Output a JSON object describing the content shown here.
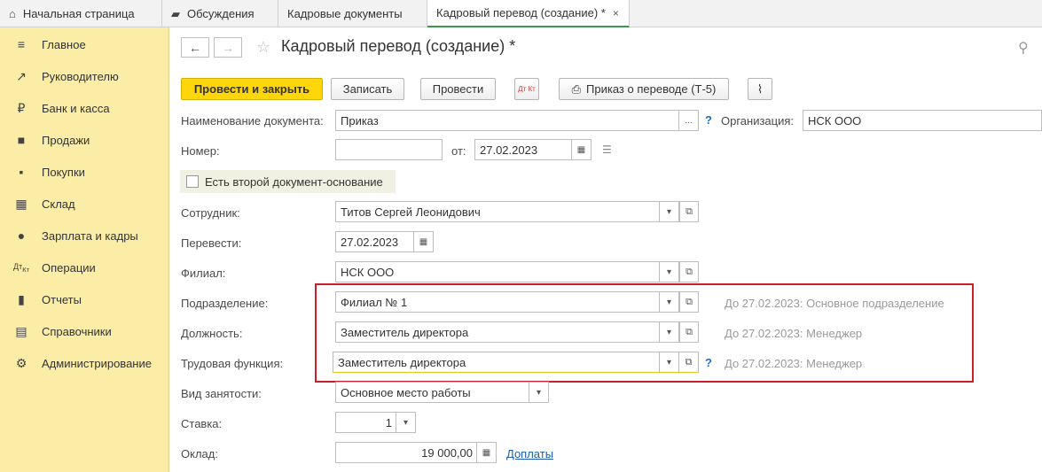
{
  "tabs": [
    {
      "label": "Начальная страница",
      "icon": "home-icon"
    },
    {
      "label": "Обсуждения",
      "icon": "chat-icon"
    },
    {
      "label": "Кадровые документы"
    },
    {
      "label": "Кадровый перевод (создание) *",
      "close": "×"
    }
  ],
  "sidebar": {
    "items": [
      {
        "label": "Главное",
        "icon": "menu-icon"
      },
      {
        "label": "Руководителю",
        "icon": "trend-icon"
      },
      {
        "label": "Банк и касса",
        "icon": "ruble-icon"
      },
      {
        "label": "Продажи",
        "icon": "shopping-bag-icon"
      },
      {
        "label": "Покупки",
        "icon": "cart-icon"
      },
      {
        "label": "Склад",
        "icon": "grid-icon"
      },
      {
        "label": "Зарплата и кадры",
        "icon": "person-icon"
      },
      {
        "label": "Операции",
        "icon": "dt-kt-icon"
      },
      {
        "label": "Отчеты",
        "icon": "bar-chart-icon"
      },
      {
        "label": "Справочники",
        "icon": "books-icon"
      },
      {
        "label": "Администрирование",
        "icon": "gear-icon"
      }
    ]
  },
  "header": {
    "title": "Кадровый перевод (создание) *"
  },
  "toolbar": {
    "post_close": "Провести и закрыть",
    "save": "Записать",
    "post": "Провести",
    "dtkt": "Дт Кт",
    "print": "Приказ о переводе (Т-5)"
  },
  "form": {
    "doc_name_label": "Наименование документа:",
    "doc_name_value": "Приказ",
    "doc_name_dots": "...",
    "org_label": "Организация:",
    "org_value": "НСК ООО",
    "number_label": "Номер:",
    "number_value": "",
    "from_label": "от:",
    "date_value": "27.02.2023",
    "second_basis_label": "Есть второй документ-основание",
    "employee_label": "Сотрудник:",
    "employee_value": "Титов Сергей Леонидович",
    "transfer_label": "Перевести:",
    "transfer_value": "27.02.2023",
    "branch_label": "Филиал:",
    "branch_value": "НСК ООО",
    "division_label": "Подразделение:",
    "division_value": "Филиал № 1",
    "division_hint": "До 27.02.2023: Основное подразделение",
    "position_label": "Должность:",
    "position_value": "Заместитель директора",
    "position_hint": "До 27.02.2023: Менеджер",
    "function_label": "Трудовая функция:",
    "function_value": "Заместитель директора",
    "function_hint": "До 27.02.2023: Менеджер",
    "employment_label": "Вид занятости:",
    "employment_value": "Основное место работы",
    "rate_label": "Ставка:",
    "rate_value": "1",
    "salary_label": "Оклад:",
    "salary_value": "19 000,00",
    "allowances_link": "Доплаты",
    "help": "?"
  }
}
